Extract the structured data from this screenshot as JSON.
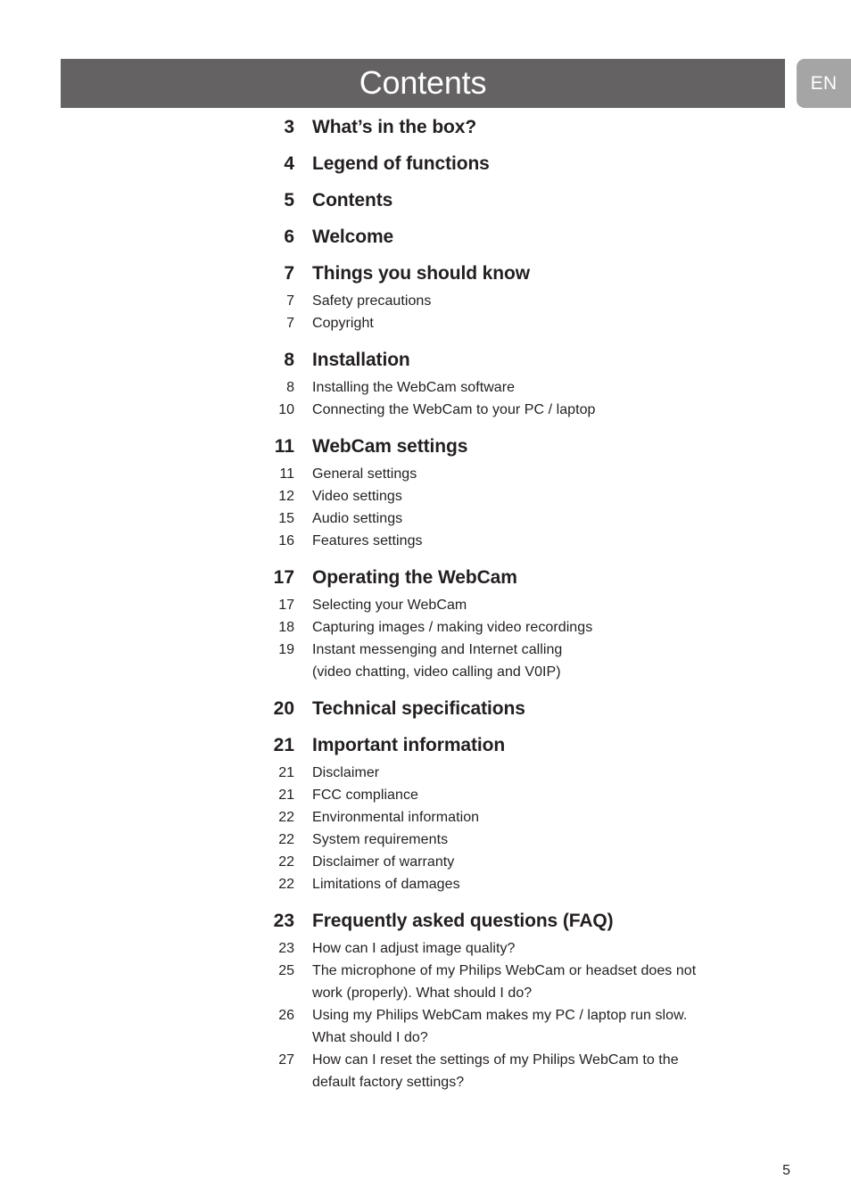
{
  "header": {
    "title": "Contents",
    "language_tab": "EN"
  },
  "page_number": "5",
  "toc": {
    "groups": [
      {
        "number": "3",
        "title": "What’s in the box?",
        "items": []
      },
      {
        "number": "4",
        "title": "Legend of functions",
        "items": []
      },
      {
        "number": "5",
        "title": "Contents",
        "items": []
      },
      {
        "number": "6",
        "title": "Welcome",
        "items": []
      },
      {
        "number": "7",
        "title": "Things you should know",
        "items": [
          {
            "number": "7",
            "label": "Safety precautions",
            "cont": ""
          },
          {
            "number": "7",
            "label": "Copyright",
            "cont": ""
          }
        ]
      },
      {
        "number": "8",
        "title": "Installation",
        "items": [
          {
            "number": "8",
            "label": "Installing the WebCam software",
            "cont": ""
          },
          {
            "number": "10",
            "label": "Connecting the WebCam to your PC / laptop",
            "cont": ""
          }
        ]
      },
      {
        "number": "11",
        "title": "WebCam settings",
        "items": [
          {
            "number": "11",
            "label": "General settings",
            "cont": ""
          },
          {
            "number": "12",
            "label": "Video settings",
            "cont": ""
          },
          {
            "number": "15",
            "label": "Audio settings",
            "cont": ""
          },
          {
            "number": "16",
            "label": "Features settings",
            "cont": ""
          }
        ]
      },
      {
        "number": "17",
        "title": "Operating the WebCam",
        "items": [
          {
            "number": "17",
            "label": "Selecting your WebCam",
            "cont": ""
          },
          {
            "number": "18",
            "label": "Capturing images / making video recordings",
            "cont": ""
          },
          {
            "number": "19",
            "label": "Instant messenging and Internet calling",
            "cont": "(video chatting, video calling and V0IP)"
          }
        ]
      },
      {
        "number": "20",
        "title": "Technical specifications",
        "items": []
      },
      {
        "number": "21",
        "title": "Important information",
        "items": [
          {
            "number": "21",
            "label": "Disclaimer",
            "cont": ""
          },
          {
            "number": "21",
            "label": "FCC compliance",
            "cont": ""
          },
          {
            "number": "22",
            "label": "Environmental information",
            "cont": ""
          },
          {
            "number": "22",
            "label": "System requirements",
            "cont": ""
          },
          {
            "number": "22",
            "label": "Disclaimer of warranty",
            "cont": ""
          },
          {
            "number": "22",
            "label": "Limitations of damages",
            "cont": ""
          }
        ]
      },
      {
        "number": "23",
        "title": "Frequently asked questions (FAQ)",
        "items": [
          {
            "number": "23",
            "label": "How can I adjust image quality?",
            "cont": ""
          },
          {
            "number": "25",
            "label": "The microphone of my Philips WebCam or headset does not",
            "cont": "work (properly). What should I do?"
          },
          {
            "number": "26",
            "label": "Using my Philips WebCam makes my PC / laptop run slow.",
            "cont": "What should I do?"
          },
          {
            "number": "27",
            "label": "How can I reset the settings of my Philips WebCam to the",
            "cont": "default factory settings?"
          }
        ]
      }
    ]
  }
}
